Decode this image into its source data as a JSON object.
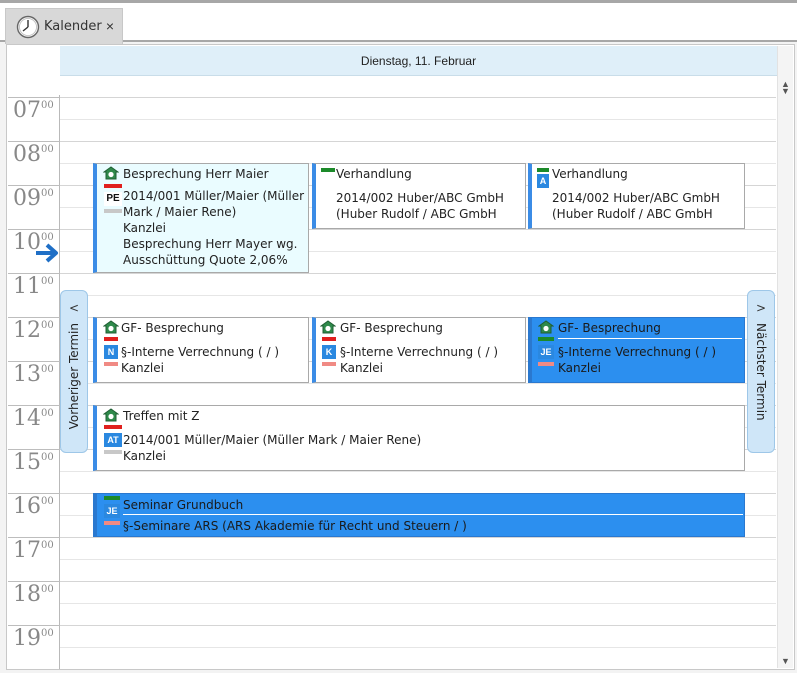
{
  "tab": {
    "label": "Kalender",
    "close": "×",
    "icon": "clock-icon"
  },
  "header": {
    "date": "Dienstag, 11. Februar"
  },
  "hours": [
    {
      "h": "07",
      "m": "00"
    },
    {
      "h": "08",
      "m": "00"
    },
    {
      "h": "09",
      "m": "00"
    },
    {
      "h": "10",
      "m": "00"
    },
    {
      "h": "11",
      "m": "00"
    },
    {
      "h": "12",
      "m": "00"
    },
    {
      "h": "13",
      "m": "00"
    },
    {
      "h": "14",
      "m": "00"
    },
    {
      "h": "15",
      "m": "00"
    },
    {
      "h": "16",
      "m": "00"
    },
    {
      "h": "17",
      "m": "00"
    },
    {
      "h": "18",
      "m": "00"
    },
    {
      "h": "19",
      "m": "00"
    }
  ],
  "nav": {
    "prev": "Vorheriger Termin",
    "prev_chev": "<",
    "next": "Nächster Termin",
    "next_chev": ">"
  },
  "appointments": [
    {
      "title": "Besprechung Herr Maier",
      "badge": "PE",
      "line1": "2014/001 Müller/Maier (Müller",
      "line2": "Mark / Maier Rene)",
      "line3": "Kanzlei",
      "line4": "Besprechung Herr Mayer wg.",
      "line5": "Ausschüttung Quote 2,06%"
    },
    {
      "title": "Verhandlung",
      "line1": "2014/002 Huber/ABC GmbH",
      "line2": "(Huber Rudolf / ABC GmbH"
    },
    {
      "title": "Verhandlung",
      "badge": "A",
      "line1": "2014/002 Huber/ABC GmbH",
      "line2": "(Huber Rudolf / ABC GmbH"
    },
    {
      "title": "GF- Besprechung",
      "badge": "N",
      "line1": "§-Interne Verrechnung ( / )",
      "line2": "Kanzlei"
    },
    {
      "title": "GF- Besprechung",
      "badge": "K",
      "line1": "§-Interne Verrechnung ( / )",
      "line2": "Kanzlei"
    },
    {
      "title": "GF- Besprechung",
      "badge": "JE",
      "line1": "§-Interne Verrechnung ( / )",
      "line2": "Kanzlei"
    },
    {
      "title": "Treffen mit Z",
      "badge": "AT",
      "line1": "2014/001 Müller/Maier (Müller Mark / Maier Rene)",
      "line2": "Kanzlei"
    },
    {
      "title": "Seminar Grundbuch",
      "badge": "JE",
      "line1": "§-Seminare ARS (ARS Akademie für Recht und Steuern / )"
    }
  ],
  "colors": {
    "accent_blue": "#2c8fef",
    "header_bg": "#dfeff9",
    "cyan_appt": "#eafcff",
    "red_bar": "#e0201e",
    "green_bar": "#1c8a2a",
    "pink_bar": "#f08a84",
    "grey_bar": "#c8c8c8",
    "badge_blue": "#2a88e0"
  }
}
